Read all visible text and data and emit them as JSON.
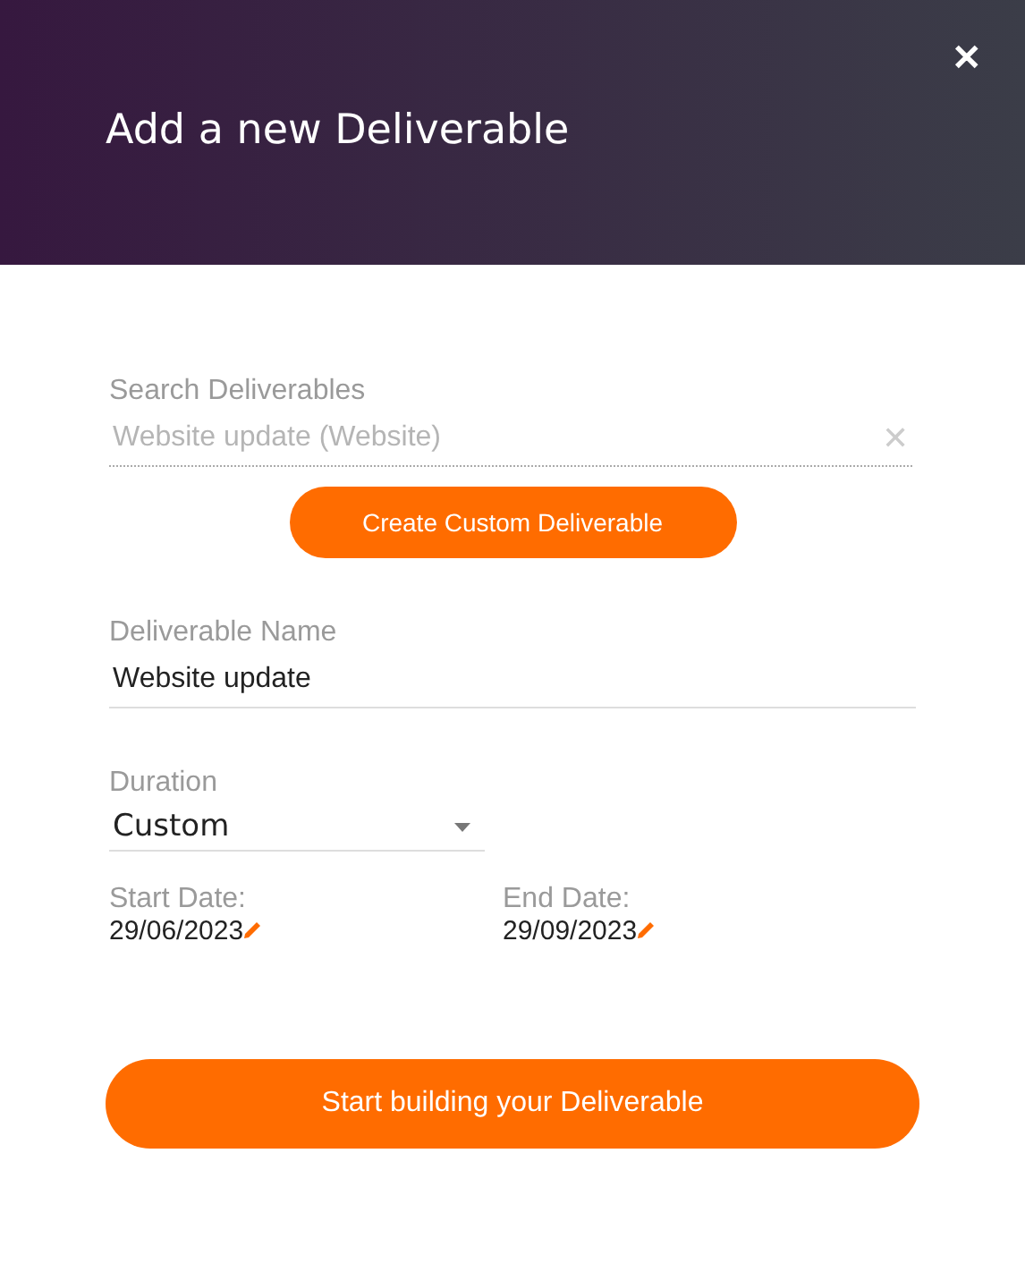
{
  "dialog": {
    "title": "Add a new Deliverable",
    "close": "✕"
  },
  "search": {
    "label": "Search Deliverables",
    "value": "Website update (Website)",
    "disabled": true,
    "clear": "✕"
  },
  "create_button": "Create Custom Deliverable",
  "name_field": {
    "label": "Deliverable Name",
    "value": "Website update"
  },
  "duration": {
    "label": "Duration",
    "value": "Custom"
  },
  "dates": [
    {
      "label": "Start Date:",
      "value": "29/06/2023"
    },
    {
      "label": "End Date:",
      "value": "29/09/2023"
    }
  ],
  "submit_button": "Start building your Deliverable"
}
